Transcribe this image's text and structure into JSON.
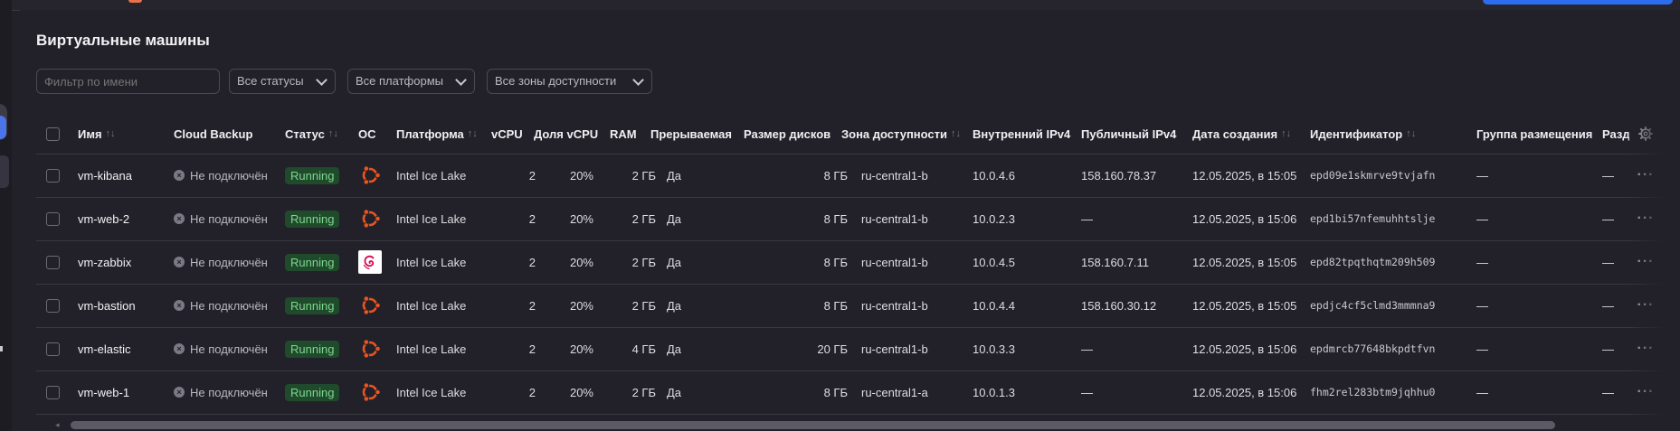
{
  "page": {
    "title": "Виртуальные машины"
  },
  "filters": {
    "name_placeholder": "Фильтр по имени",
    "status_label": "Все статусы",
    "platform_label": "Все платформы",
    "zone_label": "Все зоны доступности"
  },
  "table": {
    "headers": {
      "name": "Имя",
      "backup": "Cloud Backup",
      "status": "Статус",
      "os": "ОС",
      "platform": "Платформа",
      "vcpu": "vCPU",
      "vcpu_share": "Доля vCPU",
      "ram": "RAM",
      "preemptible": "Прерываемая",
      "disk": "Размер дисков",
      "zone": "Зона доступности",
      "ipv4_internal": "Внутренний IPv4",
      "ipv4_public": "Публичный IPv4",
      "created": "Дата создания",
      "id": "Идентификатор",
      "placement": "Группа размещения",
      "extra": "Разд"
    },
    "sort_symbol": "↑↓",
    "rows": [
      {
        "name": "vm-kibana",
        "backup": "Не подключён",
        "status": "Running",
        "os": "ubuntu",
        "platform": "Intel Ice Lake",
        "vcpu": "2",
        "vcpu_share": "20%",
        "ram": "2 ГБ",
        "preemptible": "Да",
        "disk": "8 ГБ",
        "zone": "ru-central1-b",
        "ipv4_internal": "10.0.4.6",
        "ipv4_public": "158.160.78.37",
        "created": "12.05.2025, в 15:05",
        "id": "epd09e1skmrve9tvjafn",
        "placement": "—",
        "extra": "—",
        "menu": "···"
      },
      {
        "name": "vm-web-2",
        "backup": "Не подключён",
        "status": "Running",
        "os": "ubuntu",
        "platform": "Intel Ice Lake",
        "vcpu": "2",
        "vcpu_share": "20%",
        "ram": "2 ГБ",
        "preemptible": "Да",
        "disk": "8 ГБ",
        "zone": "ru-central1-b",
        "ipv4_internal": "10.0.2.3",
        "ipv4_public": "—",
        "created": "12.05.2025, в 15:06",
        "id": "epd1bi57nfemuhhtslje",
        "placement": "—",
        "extra": "—",
        "menu": "···"
      },
      {
        "name": "vm-zabbix",
        "backup": "Не подключён",
        "status": "Running",
        "os": "debian",
        "platform": "Intel Ice Lake",
        "vcpu": "2",
        "vcpu_share": "20%",
        "ram": "2 ГБ",
        "preemptible": "Да",
        "disk": "8 ГБ",
        "zone": "ru-central1-b",
        "ipv4_internal": "10.0.4.5",
        "ipv4_public": "158.160.7.11",
        "created": "12.05.2025, в 15:05",
        "id": "epd82tpqthqtm209h509",
        "placement": "—",
        "extra": "—",
        "menu": "···"
      },
      {
        "name": "vm-bastion",
        "backup": "Не подключён",
        "status": "Running",
        "os": "ubuntu",
        "platform": "Intel Ice Lake",
        "vcpu": "2",
        "vcpu_share": "20%",
        "ram": "2 ГБ",
        "preemptible": "Да",
        "disk": "8 ГБ",
        "zone": "ru-central1-b",
        "ipv4_internal": "10.0.4.4",
        "ipv4_public": "158.160.30.12",
        "created": "12.05.2025, в 15:05",
        "id": "epdjc4cf5clmd3mmmna9",
        "placement": "—",
        "extra": "—",
        "menu": "···"
      },
      {
        "name": "vm-elastic",
        "backup": "Не подключён",
        "status": "Running",
        "os": "ubuntu",
        "platform": "Intel Ice Lake",
        "vcpu": "2",
        "vcpu_share": "20%",
        "ram": "4 ГБ",
        "preemptible": "Да",
        "disk": "20 ГБ",
        "zone": "ru-central1-b",
        "ipv4_internal": "10.0.3.3",
        "ipv4_public": "—",
        "created": "12.05.2025, в 15:06",
        "id": "epdmrcb77648bkpdtfvn",
        "placement": "—",
        "extra": "—",
        "menu": "···"
      },
      {
        "name": "vm-web-1",
        "backup": "Не подключён",
        "status": "Running",
        "os": "ubuntu",
        "platform": "Intel Ice Lake",
        "vcpu": "2",
        "vcpu_share": "20%",
        "ram": "2 ГБ",
        "preemptible": "Да",
        "disk": "8 ГБ",
        "zone": "ru-central1-a",
        "ipv4_internal": "10.0.1.3",
        "ipv4_public": "—",
        "created": "12.05.2025, в 15:06",
        "id": "fhm2rel283btm9jqhhu0",
        "placement": "—",
        "extra": "—",
        "menu": "···"
      }
    ]
  },
  "colors": {
    "background": "#222129",
    "status_running_bg": "#1f4a2b",
    "status_running_text": "#7ed68e",
    "ubuntu_orange": "#e95420",
    "debian_red": "#d70a53",
    "accent_blue": "#2d6bef"
  }
}
